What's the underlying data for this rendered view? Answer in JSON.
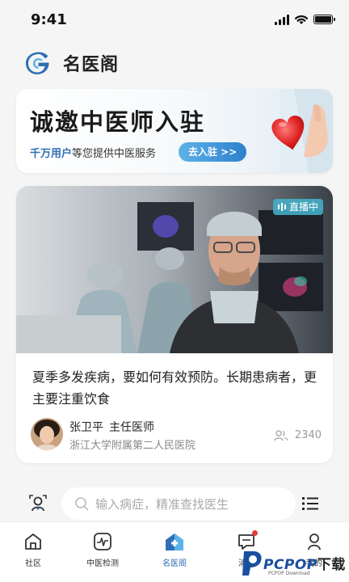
{
  "status_bar": {
    "time": "9:41"
  },
  "header": {
    "title": "名医阁"
  },
  "banner": {
    "title": "诚邀中医师入驻",
    "subtitle_highlight": "千万用户",
    "subtitle_rest": "等您提供中医服务",
    "cta_label": "去入驻 >>"
  },
  "live_card": {
    "badge_label": "直播中",
    "title": "夏季多发疾病，要如何有效预防。长期患病者，更主要注重饮食",
    "doctor": {
      "name": "张卫平",
      "title": "主任医师",
      "hospital": "浙江大学附属第二人民医院"
    },
    "viewers": "2340"
  },
  "search": {
    "placeholder": "输入病症，精准查找医生"
  },
  "bottom_nav": {
    "items": [
      {
        "label": "社区",
        "icon": "home-icon"
      },
      {
        "label": "中医检测",
        "icon": "pulse-icon"
      },
      {
        "label": "名医阁",
        "icon": "hospital-icon",
        "active": true
      },
      {
        "label": "消息",
        "icon": "message-icon"
      },
      {
        "label": "我的",
        "icon": "user-icon"
      }
    ]
  },
  "watermark": {
    "brand": "PCPOP",
    "brand_suffix": "下载",
    "sub": "PCPOP Download"
  },
  "colors": {
    "accent": "#2f6fb6",
    "live_badge": "#46afc8",
    "background": "#f5f5f5"
  }
}
